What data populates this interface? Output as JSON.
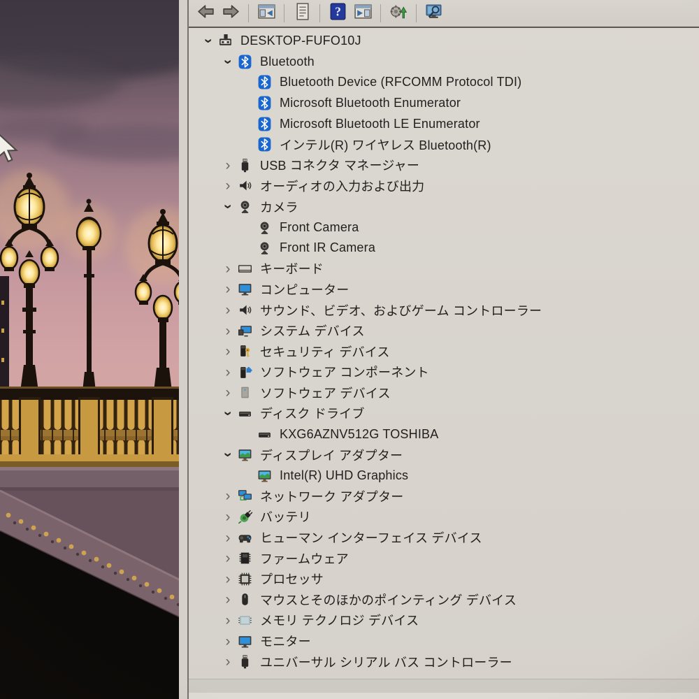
{
  "computer_name": "DESKTOP-FUFO10J",
  "toolbar": {
    "buttons": [
      {
        "id": "back",
        "icon": "arrow-left-icon"
      },
      {
        "id": "forward",
        "icon": "arrow-right-icon"
      },
      {
        "id": "separator"
      },
      {
        "id": "show-console-tree",
        "icon": "console-tree-icon"
      },
      {
        "id": "separator"
      },
      {
        "id": "properties",
        "icon": "properties-icon"
      },
      {
        "id": "separator"
      },
      {
        "id": "help",
        "icon": "help-icon"
      },
      {
        "id": "show-action-pane",
        "icon": "action-pane-icon"
      },
      {
        "id": "separator"
      },
      {
        "id": "scan-hardware-changes",
        "icon": "scan-hardware-icon"
      },
      {
        "id": "separator"
      },
      {
        "id": "device-search",
        "icon": "computer-search-icon"
      }
    ]
  },
  "tree": {
    "items": [
      {
        "id": "desktop-fufo10j",
        "label": "DESKTOP-FUFO10J",
        "level": 0,
        "state": "expanded",
        "icon": "computer-icon"
      },
      {
        "id": "bluetooth",
        "label": "Bluetooth",
        "level": 1,
        "state": "expanded",
        "icon": "bluetooth-icon"
      },
      {
        "id": "bluetooth-device-rfcomm-tdi",
        "label": "Bluetooth Device (RFCOMM Protocol TDI)",
        "level": 2,
        "state": "leaf",
        "icon": "bluetooth-icon"
      },
      {
        "id": "microsoft-bluetooth-enumerator",
        "label": "Microsoft Bluetooth Enumerator",
        "level": 2,
        "state": "leaf",
        "icon": "bluetooth-icon"
      },
      {
        "id": "microsoft-bluetooth-le-enumerator",
        "label": "Microsoft Bluetooth LE Enumerator",
        "level": 2,
        "state": "leaf",
        "icon": "bluetooth-icon"
      },
      {
        "id": "intel-wireless-bluetooth",
        "label": "インテル(R) ワイヤレス Bluetooth(R)",
        "level": 2,
        "state": "leaf",
        "icon": "bluetooth-icon"
      },
      {
        "id": "usb-connector-manager",
        "label": "USB コネクタ マネージャー",
        "level": 1,
        "state": "collapsed",
        "icon": "usb-icon"
      },
      {
        "id": "audio-inputs-outputs",
        "label": "オーディオの入力および出力",
        "level": 1,
        "state": "collapsed",
        "icon": "speaker-icon"
      },
      {
        "id": "cameras",
        "label": "カメラ",
        "level": 1,
        "state": "expanded",
        "icon": "camera-icon"
      },
      {
        "id": "front-camera",
        "label": "Front Camera",
        "level": 2,
        "state": "leaf",
        "icon": "camera-icon"
      },
      {
        "id": "front-ir-camera",
        "label": "Front IR Camera",
        "level": 2,
        "state": "leaf",
        "icon": "camera-icon"
      },
      {
        "id": "keyboards",
        "label": "キーボード",
        "level": 1,
        "state": "collapsed",
        "icon": "keyboard-icon"
      },
      {
        "id": "computer",
        "label": "コンピューター",
        "level": 1,
        "state": "collapsed",
        "icon": "monitor-icon"
      },
      {
        "id": "sound-video-game-controllers",
        "label": "サウンド、ビデオ、およびゲーム コントローラー",
        "level": 1,
        "state": "collapsed",
        "icon": "speaker-icon"
      },
      {
        "id": "system-devices",
        "label": "システム デバイス",
        "level": 1,
        "state": "collapsed",
        "icon": "system-device-icon"
      },
      {
        "id": "security-devices",
        "label": "セキュリティ デバイス",
        "level": 1,
        "state": "collapsed",
        "icon": "security-device-icon"
      },
      {
        "id": "software-components",
        "label": "ソフトウェア コンポーネント",
        "level": 1,
        "state": "collapsed",
        "icon": "software-component-icon"
      },
      {
        "id": "software-devices",
        "label": "ソフトウェア デバイス",
        "level": 1,
        "state": "collapsed",
        "icon": "software-device-icon"
      },
      {
        "id": "disk-drives",
        "label": "ディスク ドライブ",
        "level": 1,
        "state": "expanded",
        "icon": "disk-drive-icon"
      },
      {
        "id": "kxg6aznv512g-toshiba",
        "label": "KXG6AZNV512G TOSHIBA",
        "level": 2,
        "state": "leaf",
        "icon": "disk-drive-icon"
      },
      {
        "id": "display-adapters",
        "label": "ディスプレイ アダプター",
        "level": 1,
        "state": "expanded",
        "icon": "display-adapter-icon"
      },
      {
        "id": "intel-uhd-graphics",
        "label": "Intel(R) UHD Graphics",
        "level": 2,
        "state": "leaf",
        "icon": "display-adapter-icon"
      },
      {
        "id": "network-adapters",
        "label": "ネットワーク アダプター",
        "level": 1,
        "state": "collapsed",
        "icon": "network-adapter-icon"
      },
      {
        "id": "batteries",
        "label": "バッテリ",
        "level": 1,
        "state": "collapsed",
        "icon": "battery-icon"
      },
      {
        "id": "human-interface-devices",
        "label": "ヒューマン インターフェイス デバイス",
        "level": 1,
        "state": "collapsed",
        "icon": "hid-icon"
      },
      {
        "id": "firmware",
        "label": "ファームウェア",
        "level": 1,
        "state": "collapsed",
        "icon": "firmware-icon"
      },
      {
        "id": "processors",
        "label": "プロセッサ",
        "level": 1,
        "state": "collapsed",
        "icon": "processor-icon"
      },
      {
        "id": "mice-pointing-devices",
        "label": "マウスとそのほかのポインティング デバイス",
        "level": 1,
        "state": "collapsed",
        "icon": "mouse-icon"
      },
      {
        "id": "memory-technology-devices",
        "label": "メモリ テクノロジ デバイス",
        "level": 1,
        "state": "collapsed",
        "icon": "memory-icon"
      },
      {
        "id": "monitors",
        "label": "モニター",
        "level": 1,
        "state": "collapsed",
        "icon": "monitor-icon"
      },
      {
        "id": "usb-controllers",
        "label": "ユニバーサル シリアル バス コントローラー",
        "level": 1,
        "state": "collapsed",
        "icon": "usb-icon"
      }
    ]
  },
  "colors": {
    "window_bg": "#d9d5cf",
    "toolbar_bg": "#d6d2cb",
    "text": "#211f1d",
    "bluetooth_blue": "#1a66cf",
    "help_blue": "#23399c",
    "sky_pink": "#cf9fa2",
    "sky_dark": "#474049",
    "lamp_glow": "#ffe9a0",
    "gold": "#d3a449"
  }
}
